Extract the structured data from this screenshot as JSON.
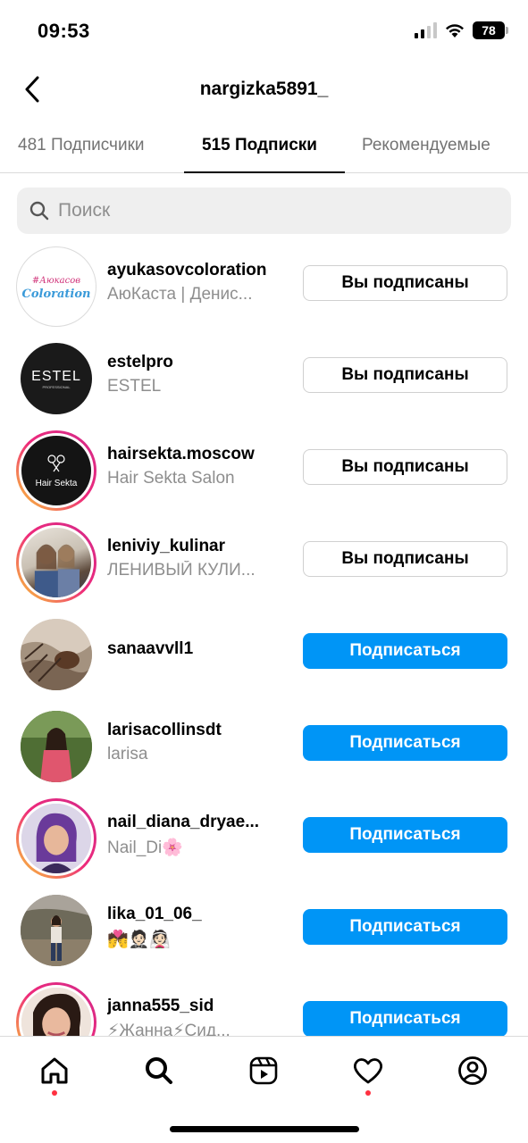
{
  "status_bar": {
    "time": "09:53",
    "battery": "78"
  },
  "header": {
    "title": "nargizka5891_"
  },
  "tabs": [
    {
      "label": "481 Подписчики",
      "active": false
    },
    {
      "label": "515 Подписки",
      "active": true
    },
    {
      "label": "Рекомендуемые",
      "active": false
    }
  ],
  "search": {
    "placeholder": "Поиск",
    "value": ""
  },
  "users": [
    {
      "username": "ayukasovcoloration",
      "fullname": "АюКаста | Денис...",
      "button": "Вы подписаны",
      "following": true,
      "story": false,
      "avatar_text": "#Аюкасов Coloration"
    },
    {
      "username": "estelpro",
      "fullname": "ESTEL",
      "button": "Вы подписаны",
      "following": true,
      "story": false,
      "avatar_text": "ESTEL"
    },
    {
      "username": "hairsekta.moscow",
      "fullname": "Hair Sekta Salon",
      "button": "Вы подписаны",
      "following": true,
      "story": true,
      "avatar_text": "Hair Sekta"
    },
    {
      "username": "leniviy_kulinar",
      "fullname": "ЛЕНИВЫЙ КУЛИ...",
      "button": "Вы подписаны",
      "following": true,
      "story": true,
      "avatar_text": ""
    },
    {
      "username": "sanaavvll1",
      "fullname": "",
      "button": "Подписаться",
      "following": false,
      "story": false,
      "avatar_text": ""
    },
    {
      "username": "larisacollinsdt",
      "fullname": "larisa",
      "button": "Подписаться",
      "following": false,
      "story": false,
      "avatar_text": ""
    },
    {
      "username": "nail_diana_dryae...",
      "fullname": "Nail_Di🌸",
      "button": "Подписаться",
      "following": false,
      "story": true,
      "avatar_text": ""
    },
    {
      "username": "lika_01_06_",
      "fullname": "💏🤵🏻👰🏻",
      "button": "Подписаться",
      "following": false,
      "story": false,
      "avatar_text": ""
    },
    {
      "username": "janna555_sid",
      "fullname": "⚡Жанна⚡Сид...",
      "button": "Подписаться",
      "following": false,
      "story": true,
      "avatar_text": ""
    }
  ],
  "bottom_nav": [
    {
      "icon": "home-icon",
      "active": true,
      "badge": true
    },
    {
      "icon": "search-icon",
      "active": false,
      "badge": false
    },
    {
      "icon": "reels-icon",
      "active": false,
      "badge": false
    },
    {
      "icon": "heart-icon",
      "active": false,
      "badge": true
    },
    {
      "icon": "profile-icon",
      "active": false,
      "badge": false
    }
  ],
  "colors": {
    "follow_blue": "#0095f6",
    "story_ring": "#ee2a7b",
    "muted_text": "#8e8e8e"
  }
}
